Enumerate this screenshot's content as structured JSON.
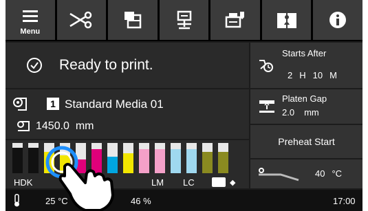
{
  "toolbar": {
    "menu_label": "Menu",
    "icons": [
      "menu-icon",
      "cutter-icon",
      "media-layers-icon",
      "media-feed-icon",
      "printer-maintenance-icon",
      "manual-book-icon",
      "info-icon"
    ]
  },
  "status": {
    "text": "Ready to print."
  },
  "media": {
    "number": "1",
    "name": "Standard Media 01",
    "remaining": "1450.0  mm"
  },
  "starts_after": {
    "title": "Starts After",
    "hours": "2",
    "h_unit": "H",
    "minutes": "10",
    "m_unit": "M"
  },
  "platen_gap": {
    "title": "Platen Gap",
    "value": "2.0",
    "unit": "mm"
  },
  "preheat": {
    "label": "Preheat Start"
  },
  "heater": {
    "value": "40",
    "unit": "°C"
  },
  "ink": {
    "labels": [
      "HDK",
      "LM",
      "LC"
    ],
    "cartridges": [
      {
        "color": "#111111",
        "level": 0.85
      },
      {
        "color": "#111111",
        "level": 0.85
      },
      {
        "color": "#f2e600",
        "level": 0.7
      },
      {
        "color": "#f2e600",
        "level": 0.6
      },
      {
        "color": "#e0007a",
        "level": 0.45
      },
      {
        "color": "#e0007a",
        "level": 0.8
      },
      {
        "color": "#00a6e0",
        "level": 0.55
      },
      {
        "color": "#f2e600",
        "level": 0.65
      },
      {
        "color": "#f4a0c8",
        "level": 0.8
      },
      {
        "color": "#f4a0c8",
        "level": 0.8
      },
      {
        "color": "#9fd8ef",
        "level": 0.8
      },
      {
        "color": "#9fd8ef",
        "level": 0.8
      },
      {
        "color": "#8a8a20",
        "level": 0.7
      },
      {
        "color": "#8a8a20",
        "level": 0.7
      }
    ]
  },
  "footer": {
    "temperature": "25 °C",
    "humidity": "46 %",
    "time": "17:00"
  }
}
